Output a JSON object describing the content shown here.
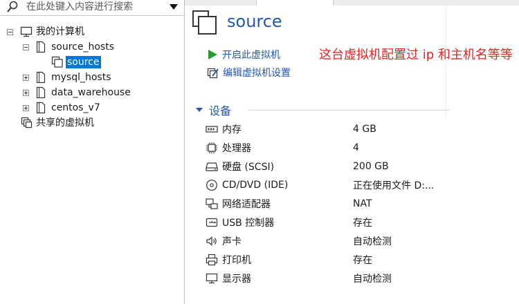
{
  "search": {
    "placeholder": "在此处键入内容进行搜索"
  },
  "tree": {
    "root": {
      "label": "我的计算机"
    },
    "source_hosts": {
      "label": "source_hosts"
    },
    "source": {
      "label": "source"
    },
    "mysql_hosts": {
      "label": "mysql_hosts"
    },
    "data_warehouse": {
      "label": "data_warehouse"
    },
    "centos_v7": {
      "label": "centos_v7"
    },
    "shared": {
      "label": "共享的虚拟机"
    }
  },
  "vm": {
    "title": "source",
    "actions": [
      {
        "label": "开启此虚拟机",
        "icon": "play-icon"
      },
      {
        "label": "编辑虚拟机设置",
        "icon": "edit-settings-icon"
      }
    ]
  },
  "annotation": {
    "text": "这台虚拟机配置过 ip 和主机名等等"
  },
  "devices": {
    "title": "设备",
    "items": [
      {
        "name": "内存",
        "value": "4 GB",
        "icon": "memory-icon"
      },
      {
        "name": "处理器",
        "value": "4",
        "icon": "processor-icon"
      },
      {
        "name": "硬盘 (SCSI)",
        "value": "200 GB",
        "icon": "hard-disk-icon"
      },
      {
        "name": "CD/DVD (IDE)",
        "value": "正在使用文件 D:...",
        "icon": "cd-dvd-icon"
      },
      {
        "name": "网络适配器",
        "value": "NAT",
        "icon": "network-adapter-icon"
      },
      {
        "name": "USB 控制器",
        "value": "存在",
        "icon": "usb-icon"
      },
      {
        "name": "声卡",
        "value": "自动检测",
        "icon": "sound-card-icon"
      },
      {
        "name": "打印机",
        "value": "存在",
        "icon": "printer-icon"
      },
      {
        "name": "显示器",
        "value": "自动检测",
        "icon": "display-icon"
      }
    ]
  },
  "colors": {
    "accent_blue": "#2356b3",
    "selection": "#0078d7",
    "annotation_red": "#e8221e",
    "play_green": "#1f9e2c"
  }
}
